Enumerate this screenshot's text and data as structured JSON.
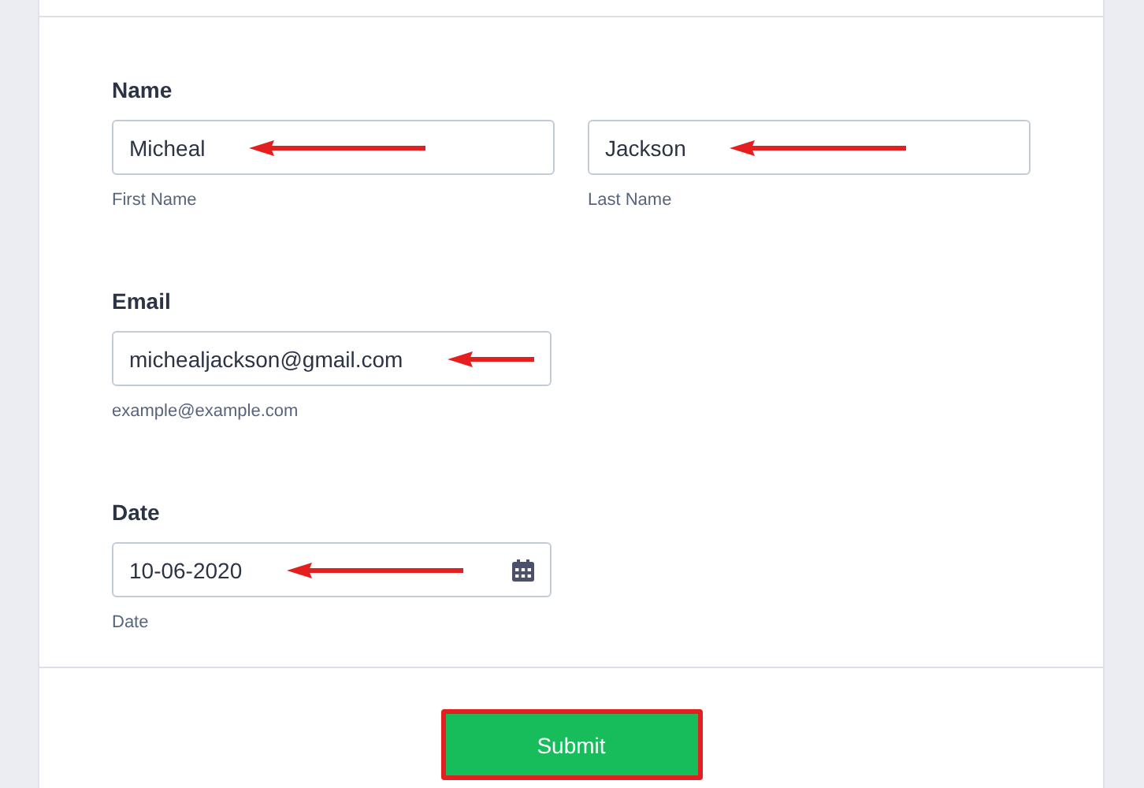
{
  "sections": [
    {
      "label": "Name",
      "fields": [
        {
          "kind": "text",
          "value": "Micheal",
          "sublabel": "First Name",
          "arrow": true
        },
        {
          "kind": "text",
          "value": "Jackson",
          "sublabel": "Last Name",
          "arrow": true
        }
      ]
    },
    {
      "label": "Email",
      "fields": [
        {
          "kind": "text",
          "value": "michealjackson@gmail.com",
          "sublabel": "example@example.com",
          "arrow": true
        }
      ]
    },
    {
      "label": "Date",
      "fields": [
        {
          "kind": "date",
          "value": "10-06-2020",
          "sublabel": "Date",
          "arrow": true
        }
      ]
    }
  ],
  "submit": {
    "label": "Submit",
    "highlighted": true
  }
}
